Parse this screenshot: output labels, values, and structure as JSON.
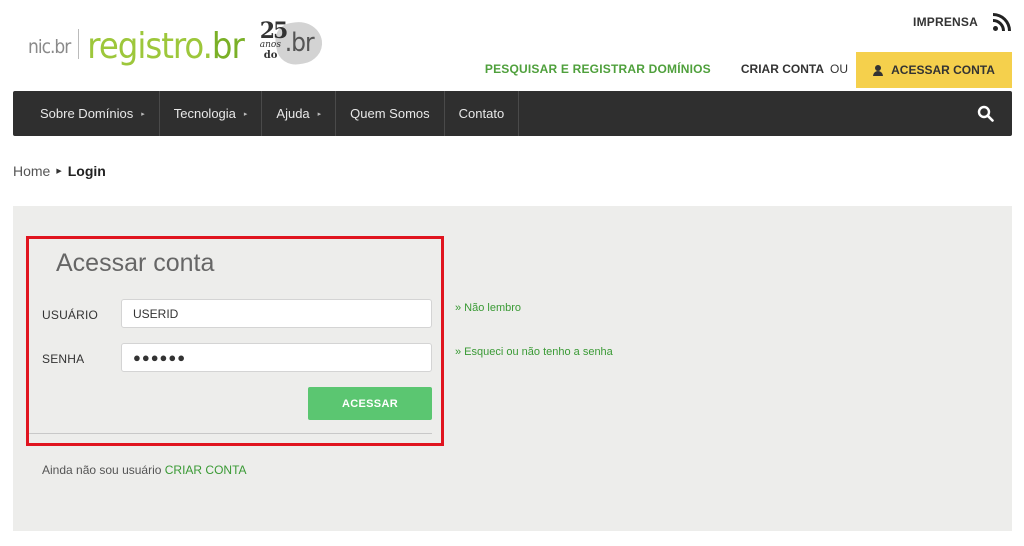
{
  "header": {
    "logo_nic": "nic.br",
    "logo_registro": "registro",
    "logo_dot": ".",
    "logo_br": "br",
    "logo_25": "25",
    "logo_anos": "anos",
    "logo_do": "do",
    "logo_br_small": ".br",
    "imprensa": "IMPRENSA",
    "pesquisar": "PESQUISAR E REGISTRAR DOMÍNIOS",
    "criar_conta": "CRIAR CONTA",
    "ou": "OU",
    "acessar_conta": "ACESSAR CONTA"
  },
  "nav": {
    "items": [
      {
        "label": "Sobre Domínios",
        "caret": "▸"
      },
      {
        "label": "Tecnologia",
        "caret": "▸"
      },
      {
        "label": "Ajuda",
        "caret": "▸"
      },
      {
        "label": "Quem Somos"
      },
      {
        "label": "Contato"
      }
    ]
  },
  "breadcrumb": {
    "home": "Home",
    "current": "Login"
  },
  "login": {
    "title": "Acessar conta",
    "usuario_label": "USUÁRIO",
    "usuario_value": "USERID",
    "senha_label": "SENHA",
    "senha_value": "●●●●●●",
    "submit_label": "ACESSAR",
    "nao_lembro": "» Não lembro",
    "esqueci": "» Esqueci ou não tenho a senha",
    "ainda_text": "Ainda não sou usuário",
    "criar_conta_link": "CRIAR CONTA"
  },
  "colors": {
    "accent_green": "#4fa03c",
    "button_green": "#5bc671",
    "yellow": "#f5d04c",
    "nav_bg": "#2f2f2f",
    "highlight_red": "#e0141f"
  },
  "icons": {
    "rss": "rss-icon",
    "user": "user-icon",
    "search": "search-icon"
  }
}
